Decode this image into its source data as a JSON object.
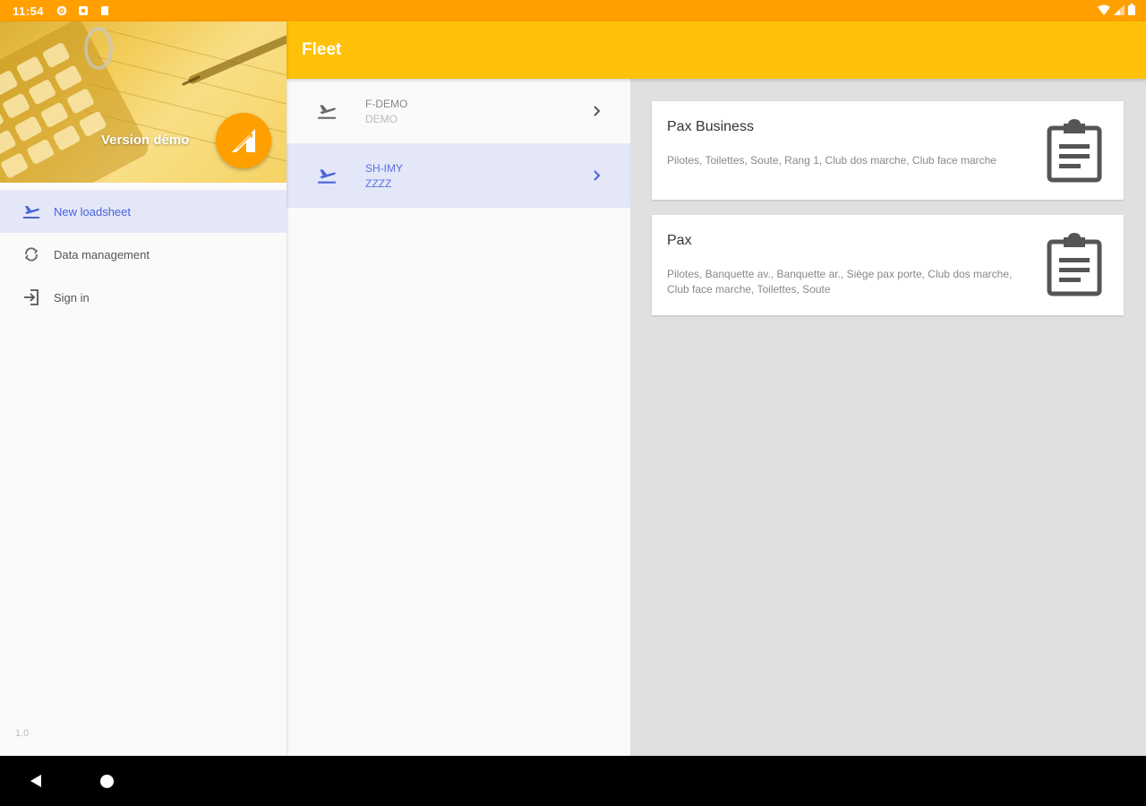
{
  "status_bar": {
    "time": "11:54",
    "left_icons": [
      "settings-icon",
      "sync-icon",
      "sd-card-icon"
    ],
    "right_icons": [
      "wifi-icon",
      "signal-icon",
      "battery-icon"
    ]
  },
  "drawer": {
    "header": {
      "version_label": "Version démo",
      "logo_icon": "loadsheet-logo-icon"
    },
    "menu": [
      {
        "label": "New loadsheet",
        "icon": "flight-takeoff-icon",
        "active": true
      },
      {
        "label": "Data management",
        "icon": "sync-icon",
        "active": false
      },
      {
        "label": "Sign in",
        "icon": "login-icon",
        "active": false
      }
    ],
    "app_version": "1.0"
  },
  "toolbar": {
    "title": "Fleet"
  },
  "fleet": [
    {
      "registration": "F-DEMO",
      "type": "DEMO",
      "selected": false
    },
    {
      "registration": "SH-IMY",
      "type": "ZZZZ",
      "selected": true
    }
  ],
  "configurations": [
    {
      "title": "Pax Business",
      "description": "Pilotes, Toilettes, Soute, Rang 1, Club dos marche, Club face marche",
      "icon": "clipboard-icon"
    },
    {
      "title": "Pax",
      "description": "Pilotes, Banquette av., Banquette ar., Siège pax porte, Club dos marche, Club face marche, Toilettes, Soute",
      "icon": "clipboard-icon"
    }
  ],
  "colors": {
    "status_bar": "#ffa000",
    "toolbar": "#ffc107",
    "fab": "#ff9f00",
    "selected_bg": "#e3e7f8",
    "accent": "#4a63d8"
  }
}
